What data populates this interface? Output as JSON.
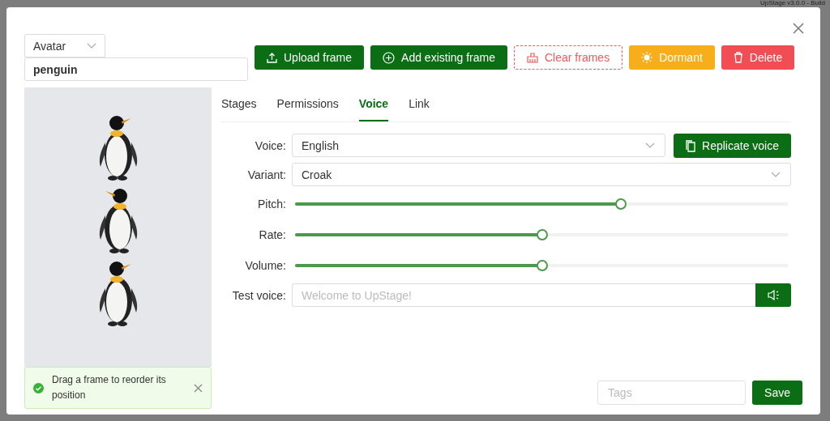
{
  "background": {
    "version_text": "UpStage v3.0.0 - Build"
  },
  "modal": {
    "avatar_type": "Avatar",
    "name_value": "penguin",
    "actions": [
      {
        "label": "Upload frame",
        "kind": "upload"
      },
      {
        "label": "Add existing frame",
        "kind": "add"
      },
      {
        "label": "Clear frames",
        "kind": "clear"
      },
      {
        "label": "Dormant",
        "kind": "dormant"
      },
      {
        "label": "Delete",
        "kind": "delete"
      }
    ],
    "notification": {
      "text": "Drag a frame to reorder its position"
    },
    "tabs": [
      {
        "label": "Stages",
        "selected": false
      },
      {
        "label": "Permissions",
        "selected": false
      },
      {
        "label": "Voice",
        "selected": true
      },
      {
        "label": "Link",
        "selected": false
      }
    ],
    "voice": {
      "label": "Voice:",
      "value": "English",
      "replicate_label": "Replicate voice"
    },
    "variant": {
      "label": "Variant:",
      "value": "Croak"
    },
    "sliders": [
      {
        "label": "Pitch:",
        "level": 0.66
      },
      {
        "label": "Rate:",
        "level": 0.5
      },
      {
        "label": "Volume:",
        "level": 0.5
      }
    ],
    "test_voice": {
      "label": "Test voice:",
      "placeholder": "Welcome to UpStage!"
    },
    "tags": {
      "placeholder": "Tags"
    },
    "save_label": "Save"
  }
}
